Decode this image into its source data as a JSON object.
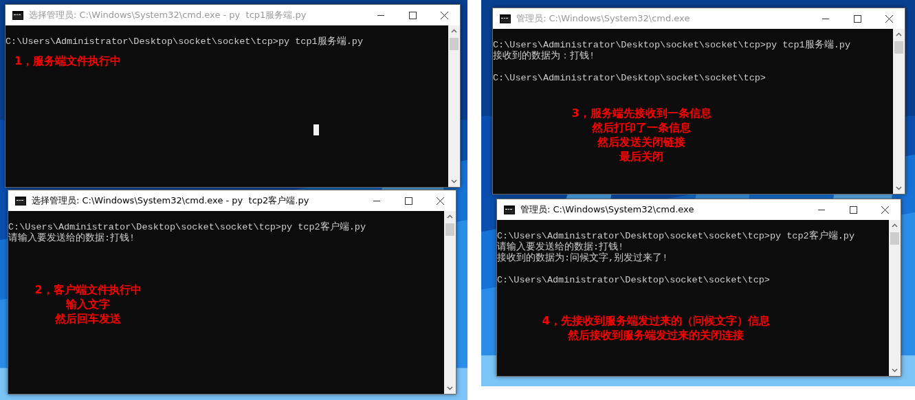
{
  "windows": [
    {
      "title": "选择管理员: C:\\Windows\\System32\\cmd.exe - py  tcp1服务端.py",
      "active": false,
      "cursor_visible": true,
      "lines": [
        {
          "text": "C:\\Users\\Administrator\\Desktop\\socket\\socket\\tcp>py tcp1服务端.py",
          "gap_before": false
        }
      ],
      "annotation": [
        "1，服务端文件执行中"
      ]
    },
    {
      "title": "选择管理员: C:\\Windows\\System32\\cmd.exe - py  tcp2客户端.py",
      "active": true,
      "cursor_visible": false,
      "lines": [
        {
          "text": "C:\\Users\\Administrator\\Desktop\\socket\\socket\\tcp>py tcp2客户端.py",
          "gap_before": false
        },
        {
          "text": "请输入要发送给的数据:打钱!",
          "gap_before": false
        }
      ],
      "annotation": [
        "2，客户端文件执行中",
        "输入文字",
        "然后回车发送"
      ]
    },
    {
      "title": "管理员: C:\\Windows\\System32\\cmd.exe",
      "active": false,
      "cursor_visible": false,
      "lines": [
        {
          "text": "C:\\Users\\Administrator\\Desktop\\socket\\socket\\tcp>py tcp1服务端.py",
          "gap_before": false
        },
        {
          "text": "接收到的数据为：打钱!",
          "gap_before": false
        },
        {
          "text": "C:\\Users\\Administrator\\Desktop\\socket\\socket\\tcp>",
          "gap_before": true
        }
      ],
      "annotation": [
        "3，服务端先接收到一条信息",
        "然后打印了一条信息",
        "然后发送关闭链接",
        "最后关闭"
      ]
    },
    {
      "title": "管理员: C:\\Windows\\System32\\cmd.exe",
      "active": true,
      "cursor_visible": false,
      "lines": [
        {
          "text": "C:\\Users\\Administrator\\Desktop\\socket\\socket\\tcp>py tcp2客户端.py",
          "gap_before": false
        },
        {
          "text": "请输入要发送给的数据:打钱!",
          "gap_before": false
        },
        {
          "text": "接收到的数据为:问候文字,别发过来了!",
          "gap_before": false
        },
        {
          "text": "C:\\Users\\Administrator\\Desktop\\socket\\socket\\tcp>",
          "gap_before": true
        }
      ],
      "annotation": [
        "4，先接收到服务端发过来的（问候文字）信息",
        "然后接收到服务端发过来的关闭连接"
      ]
    }
  ]
}
